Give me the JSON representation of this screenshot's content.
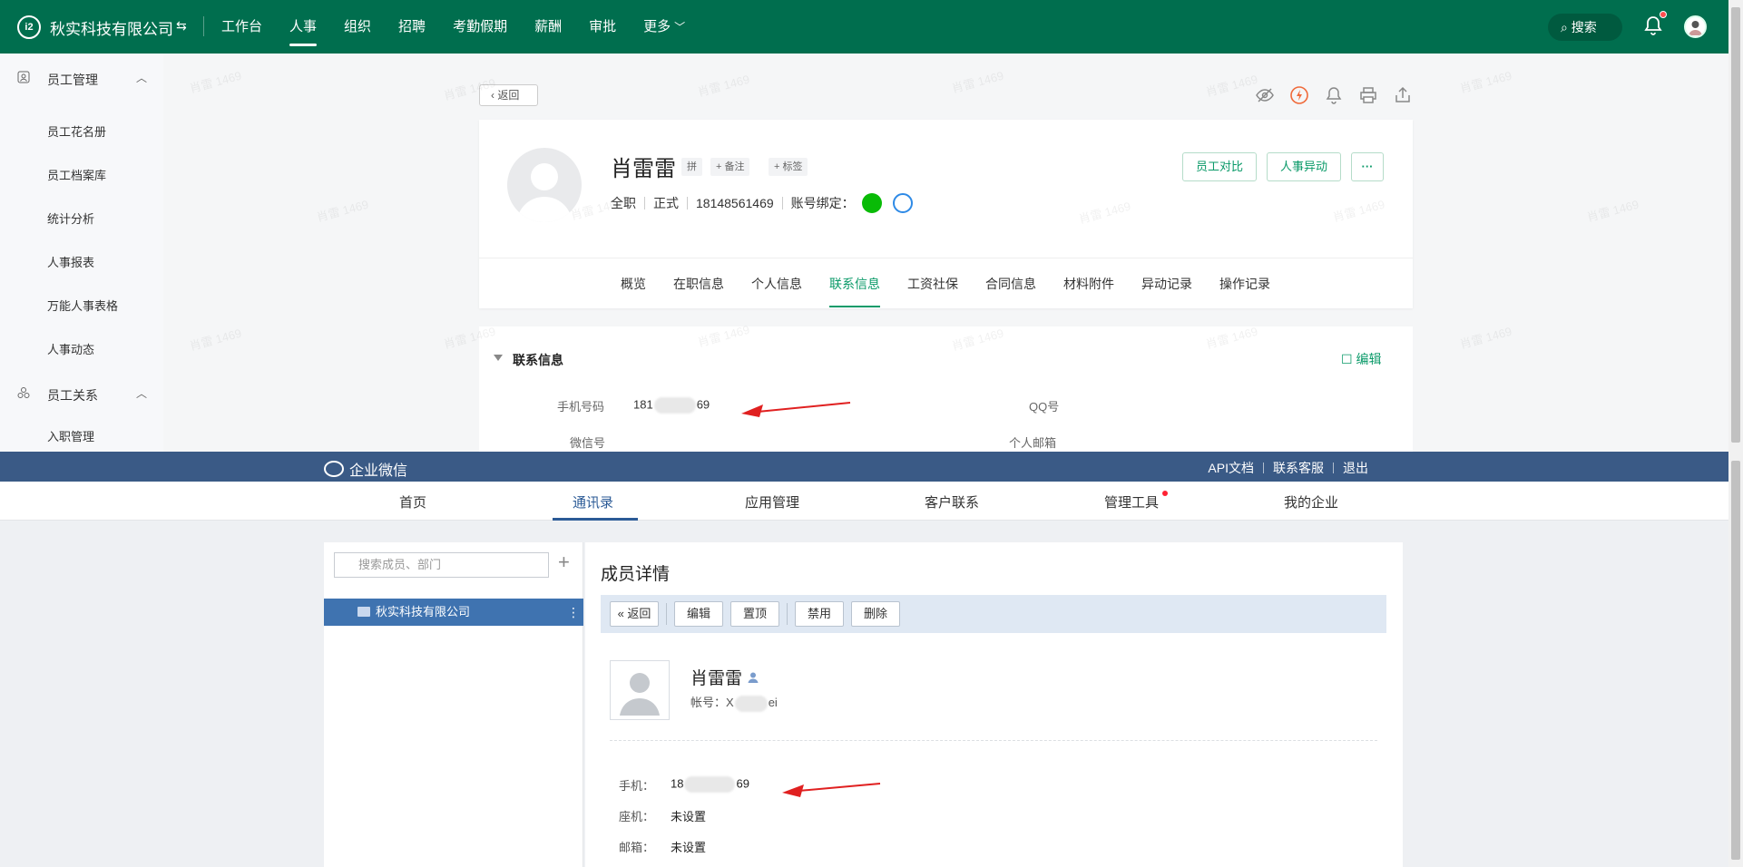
{
  "hr": {
    "company": "秋实科技有限公司",
    "logo_text": "i2",
    "nav": [
      {
        "label": "工作台",
        "active": false
      },
      {
        "label": "人事",
        "active": true
      },
      {
        "label": "组织",
        "active": false
      },
      {
        "label": "招聘",
        "active": false
      },
      {
        "label": "考勤假期",
        "active": false
      },
      {
        "label": "薪酬",
        "active": false
      },
      {
        "label": "审批",
        "active": false
      },
      {
        "label": "更多",
        "active": false
      }
    ],
    "search_label": "搜索",
    "sidebar": {
      "group1": "员工管理",
      "items1": [
        "员工花名册",
        "员工档案库",
        "统计分析",
        "人事报表",
        "万能人事表格",
        "人事动态"
      ],
      "group2": "员工关系",
      "items2": [
        "入职管理"
      ]
    },
    "back_label": "返回",
    "profile": {
      "name": "肖雷雷",
      "pinyin_tag": "拼",
      "note_tag": "+ 备注",
      "label_tag": "+ 标签",
      "employment_type": "全职",
      "status": "正式",
      "phone": "18148561469",
      "account_binding": "账号绑定：",
      "buttons": {
        "compare": "员工对比",
        "change": "人事异动",
        "more": "···"
      }
    },
    "tabs": [
      {
        "label": "概览",
        "active": false
      },
      {
        "label": "在职信息",
        "active": false
      },
      {
        "label": "个人信息",
        "active": false
      },
      {
        "label": "联系信息",
        "active": true
      },
      {
        "label": "工资社保",
        "active": false
      },
      {
        "label": "合同信息",
        "active": false
      },
      {
        "label": "材料附件",
        "active": false
      },
      {
        "label": "异动记录",
        "active": false
      },
      {
        "label": "操作记录",
        "active": false
      }
    ],
    "contact": {
      "title": "联系信息",
      "edit": "编辑",
      "phone_label": "手机号码",
      "phone_prefix": "181",
      "phone_suffix": "69",
      "qq_label": "QQ号",
      "wechat_label": "微信号",
      "email_label": "个人邮箱"
    },
    "watermark": "肖雷 1469"
  },
  "wx": {
    "brand": "企业微信",
    "links": [
      "API文档",
      "联系客服",
      "退出"
    ],
    "nav": [
      {
        "label": "首页",
        "active": false
      },
      {
        "label": "通讯录",
        "active": true
      },
      {
        "label": "应用管理",
        "active": false
      },
      {
        "label": "客户联系",
        "active": false
      },
      {
        "label": "管理工具",
        "active": false
      },
      {
        "label": "我的企业",
        "active": false
      }
    ],
    "search_placeholder": "搜索成员、部门",
    "dept": "秋实科技有限公司",
    "dept_more": "⋮",
    "title": "成员详情",
    "toolbar": {
      "back": "« 返回",
      "edit": "编辑",
      "pin": "置顶",
      "disable": "禁用",
      "delete": "删除"
    },
    "member": {
      "name": "肖雷雷",
      "account_label": "帐号：",
      "account_prefix": "X",
      "account_suffix": "ei",
      "mobile_label": "手机：",
      "mobile_prefix": "18",
      "mobile_suffix": "69",
      "landline_label": "座机：",
      "landline_value": "未设置",
      "email_label": "邮箱：",
      "email_value": "未设置"
    }
  },
  "colors": {
    "hr_green": "#006e4e",
    "accent_green": "#0b9a69",
    "wx_blue": "#3a5a86",
    "arrow_red": "#e02020"
  }
}
